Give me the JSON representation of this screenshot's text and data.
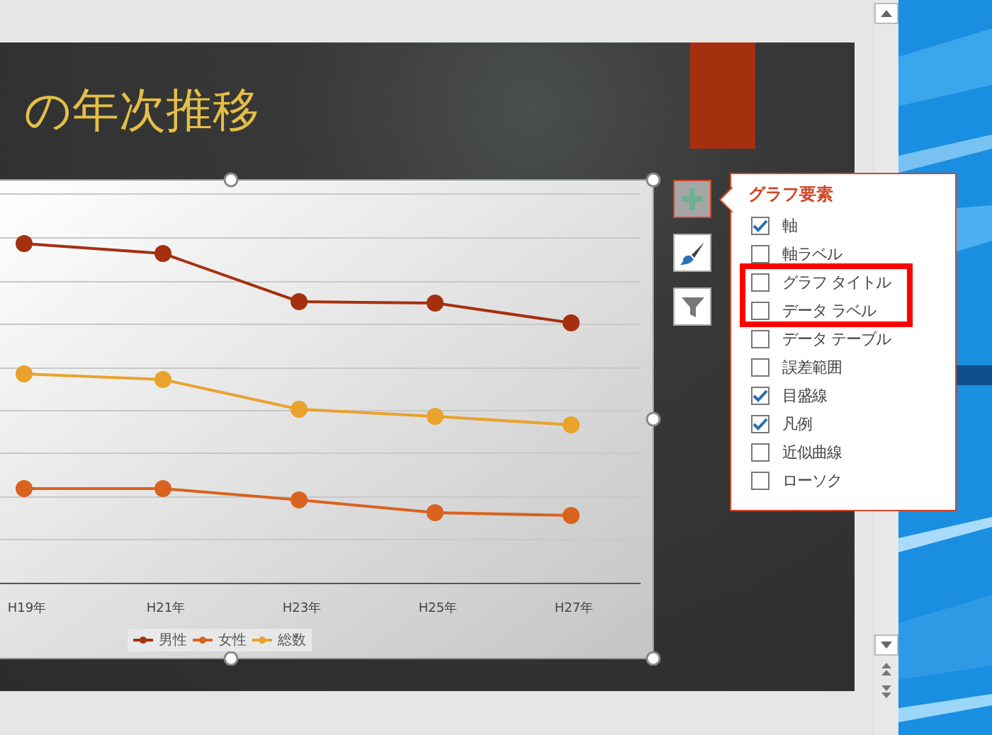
{
  "slide": {
    "title": "の年次推移"
  },
  "chart": {
    "x_labels": [
      "H19年",
      "H21年",
      "H23年",
      "H25年",
      "H27年"
    ],
    "legend": [
      {
        "label": "男性",
        "color": "#a5300f"
      },
      {
        "label": "女性",
        "color": "#d9621f"
      },
      {
        "label": "総数",
        "color": "#e9a22c"
      }
    ]
  },
  "chart_buttons": [
    {
      "kind": "elements",
      "selected": true
    },
    {
      "kind": "styles",
      "selected": false
    },
    {
      "kind": "filters",
      "selected": false
    }
  ],
  "popup": {
    "title": "グラフ要素",
    "items": [
      {
        "label": "軸",
        "checked": true
      },
      {
        "label": "軸ラベル",
        "checked": false
      },
      {
        "label": "グラフ タイトル",
        "checked": false
      },
      {
        "label": "データ ラベル",
        "checked": false
      },
      {
        "label": "データ テーブル",
        "checked": false
      },
      {
        "label": "誤差範囲",
        "checked": false
      },
      {
        "label": "目盛線",
        "checked": true
      },
      {
        "label": "凡例",
        "checked": true
      },
      {
        "label": "近似曲線",
        "checked": false
      },
      {
        "label": "ローソク",
        "checked": false
      }
    ]
  }
}
